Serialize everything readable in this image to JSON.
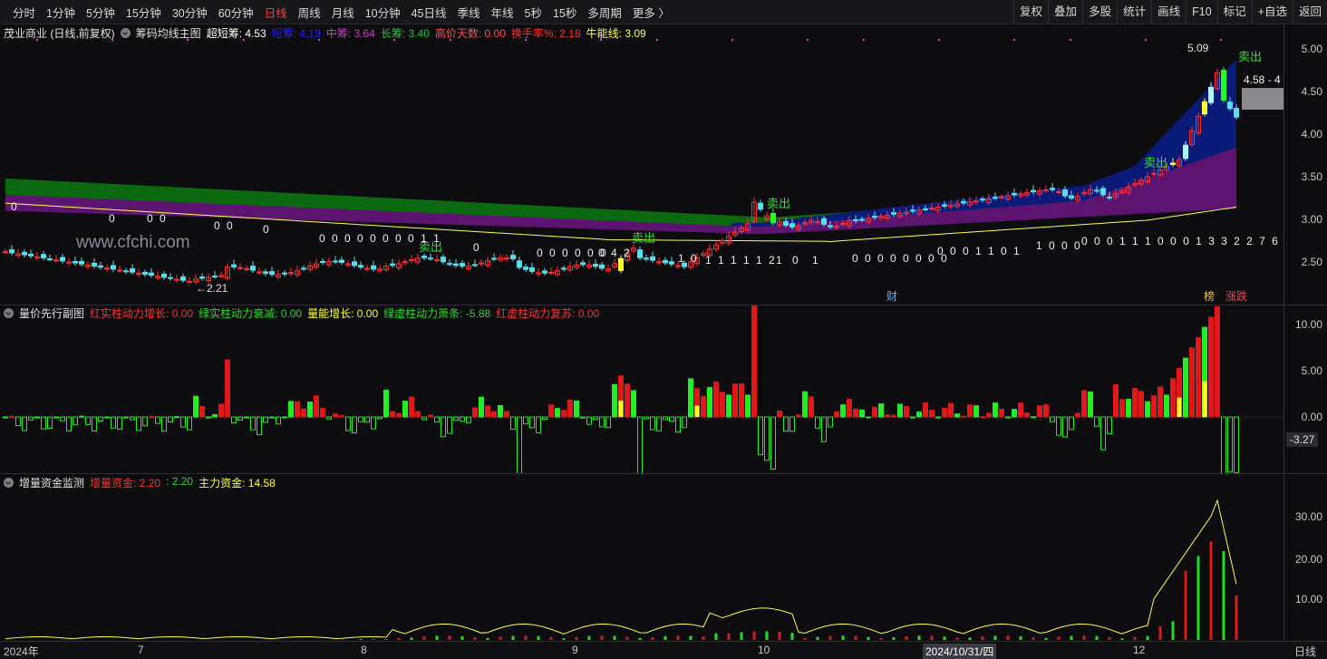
{
  "toolbar": {
    "periods": [
      "分时",
      "1分钟",
      "5分钟",
      "15分钟",
      "30分钟",
      "60分钟",
      "日线",
      "周线",
      "月线",
      "10分钟",
      "45日线",
      "季线",
      "年线",
      "5秒",
      "15秒",
      "多周期",
      "更多 〉"
    ],
    "active_period": "日线",
    "right_buttons": [
      "复权",
      "叠加",
      "多股",
      "统计",
      "画线",
      "F10",
      "标记",
      "+自选",
      "返回"
    ]
  },
  "main_panel": {
    "stock": "茂业商业 (日线,前复权)",
    "indicator": "筹码均线主图",
    "items": [
      {
        "label": "超短筹:",
        "value": "4.53",
        "color": "#ffffff"
      },
      {
        "label": "短筹:",
        "value": "4.19",
        "color": "#2020ff"
      },
      {
        "label": "中筹:",
        "value": "3.64",
        "color": "#c040c0"
      },
      {
        "label": "长筹:",
        "value": "3.40",
        "color": "#22c040"
      },
      {
        "label": "高价天数:",
        "value": "0.00",
        "color": "#ff5050"
      },
      {
        "label": "换手率%:",
        "value": "2.18",
        "color": "#ff3030"
      },
      {
        "label": "牛能线:",
        "value": "3.09",
        "color": "#ffff40"
      }
    ],
    "watermark": "www.cfchi.com",
    "y_ticks": [
      "5.00",
      "4.50",
      "4.00",
      "3.50",
      "3.00",
      "2.50"
    ],
    "price_label": "4.58 - 4",
    "high_label": "5.09",
    "low_label": "2.21",
    "sell_label": "卖出",
    "event_labels": [
      "财",
      "榜",
      "涨跌"
    ],
    "day_counts": [
      "0",
      "0",
      "0 0",
      "0 0",
      "0",
      "0 0 0 0 0 0 0 0 1 1",
      "0",
      "0 0 0 0 0 0",
      "0 4 2",
      "1 0",
      "1 1 1 1 1 2",
      "1",
      "0",
      "1",
      "0 0 0 0 0 0 0 0",
      "0 0 0 1 1 0 1",
      "1 0 0 0",
      "0 0 0 1 1 1 0 0 0 1 3 3 2 2 7 6 2"
    ]
  },
  "sub_panel_1": {
    "name": "量价先行副图",
    "items": [
      {
        "label": "红实柱动力增长:",
        "value": "0.00",
        "color": "#ff3030"
      },
      {
        "label": "绿实柱动力衰减:",
        "value": "0.00",
        "color": "#22dd22"
      },
      {
        "label": "量能增长:",
        "value": "0.00",
        "color": "#ffff30"
      },
      {
        "label": "绿虚柱动力萧条:",
        "value": "-5.88",
        "color": "#22dd22"
      },
      {
        "label": "红虚柱动力复苏:",
        "value": "0.00",
        "color": "#ff3030"
      }
    ],
    "y_ticks": [
      "10.00",
      "5.00",
      "0.00"
    ],
    "current_value": "-3.27"
  },
  "sub_panel_2": {
    "name": "增量资金监测",
    "items": [
      {
        "label": "增量资金:",
        "value": "2.20",
        "color": "#ff3030"
      },
      {
        "label": ":",
        "value": "2.20",
        "color": "#22dd22"
      },
      {
        "label": "主力资金:",
        "value": "14.58",
        "color": "#ffff30"
      }
    ],
    "y_ticks": [
      "30.00",
      "20.00",
      "10.00"
    ]
  },
  "date_axis": {
    "labels": [
      "2024年",
      "7",
      "8",
      "9",
      "10",
      "2024/10/31/四",
      "12"
    ],
    "period": "日线"
  },
  "colors": {
    "up": "#ff3030",
    "down": "#55e0f0",
    "ma": "#ffff50",
    "band_long": "#0b6a10",
    "band_mid": "#5c1470",
    "band_short": "#0a1a78"
  }
}
